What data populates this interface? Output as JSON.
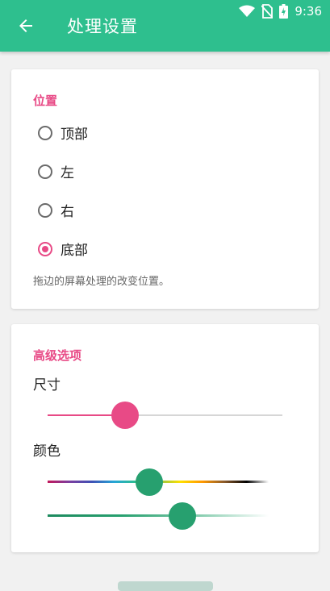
{
  "status_bar": {
    "time": "9:36",
    "icons": [
      "wifi-icon",
      "no-sim-icon",
      "battery-charging-icon"
    ]
  },
  "app_bar": {
    "title": "处理设置",
    "back_icon": "arrow-left-icon",
    "color": "#2ebf8e"
  },
  "position_section": {
    "title": "位置",
    "options": [
      {
        "label": "顶部",
        "selected": false
      },
      {
        "label": "左",
        "selected": false
      },
      {
        "label": "右",
        "selected": false
      },
      {
        "label": "底部",
        "selected": true
      }
    ],
    "hint": "拖边的屏幕处理的改变位置。"
  },
  "advanced_section": {
    "title": "高级选项",
    "size_label": "尺寸",
    "size_value_fraction": 0.33,
    "color_label": "颜色",
    "hue_value_fraction": 0.46,
    "shade_value_fraction": 0.61
  },
  "accent_color": "#e84a86",
  "thumb_color": "#27a06f"
}
